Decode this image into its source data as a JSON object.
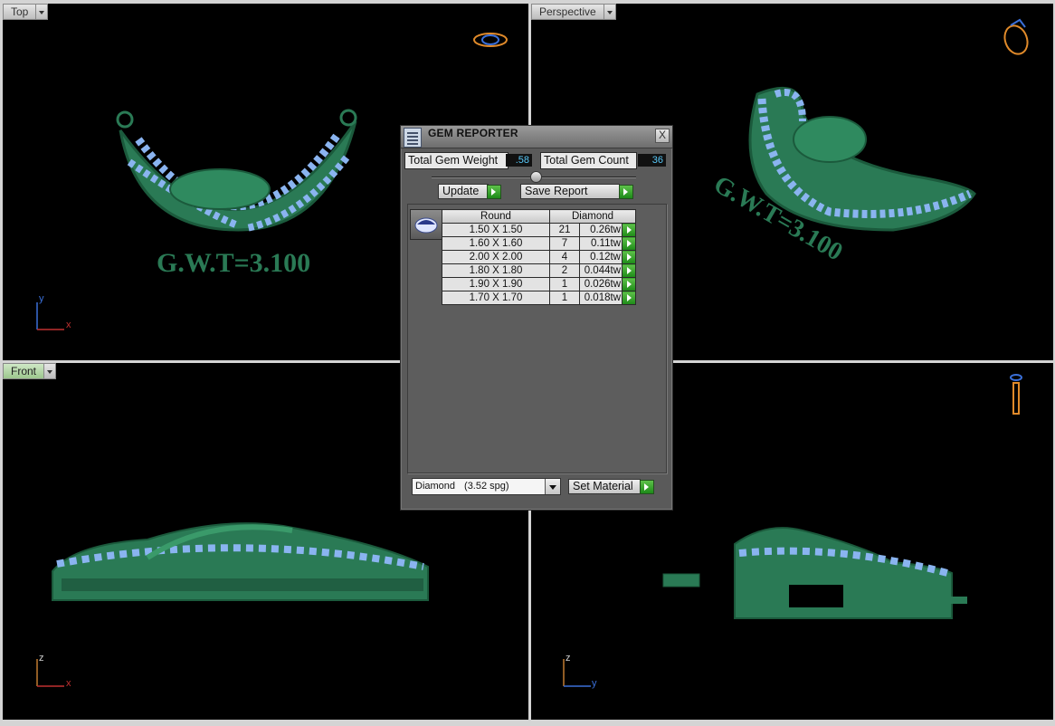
{
  "viewports": {
    "top": {
      "label": "Top",
      "active": false,
      "axes": [
        "y",
        "x"
      ]
    },
    "perspective": {
      "label": "Perspective",
      "active": false
    },
    "front": {
      "label": "Front",
      "active": true,
      "axes": [
        "z",
        "x"
      ]
    },
    "right": {
      "axes": [
        "z",
        "y"
      ]
    }
  },
  "engraving": "G.W.T=3.100",
  "gem_reporter": {
    "title": "GEM REPORTER",
    "close": "X",
    "total_weight_label": "Total Gem Weight",
    "total_weight_value": ".58",
    "total_count_label": "Total Gem Count",
    "total_count_value": "36",
    "update_label": "Update",
    "save_report_label": "Save Report",
    "table_headers": {
      "shape": "Round",
      "material": "Diamond"
    },
    "rows": [
      {
        "size": "1.50 X 1.50",
        "count": "21",
        "weight": "0.26tw"
      },
      {
        "size": "1.60 X 1.60",
        "count": "7",
        "weight": "0.11tw"
      },
      {
        "size": "2.00 X 2.00",
        "count": "4",
        "weight": "0.12tw"
      },
      {
        "size": "1.80 X 1.80",
        "count": "2",
        "weight": "0.044tw"
      },
      {
        "size": "1.90 X 1.90",
        "count": "1",
        "weight": "0.026tw"
      },
      {
        "size": "1.70 X 1.70",
        "count": "1",
        "weight": "0.018tw"
      }
    ],
    "material_select": {
      "name": "Diamond",
      "density": "(3.52 spg)"
    },
    "set_material_label": "Set Material"
  },
  "colors": {
    "metal": "#2a7a55",
    "gem": "#8ab4f0",
    "viewport_bg": "#000000",
    "axis_x": "#c03030",
    "axis_y": "#3a6fd8",
    "axis_z": "#c07a30",
    "value_text": "#58c8f8"
  }
}
